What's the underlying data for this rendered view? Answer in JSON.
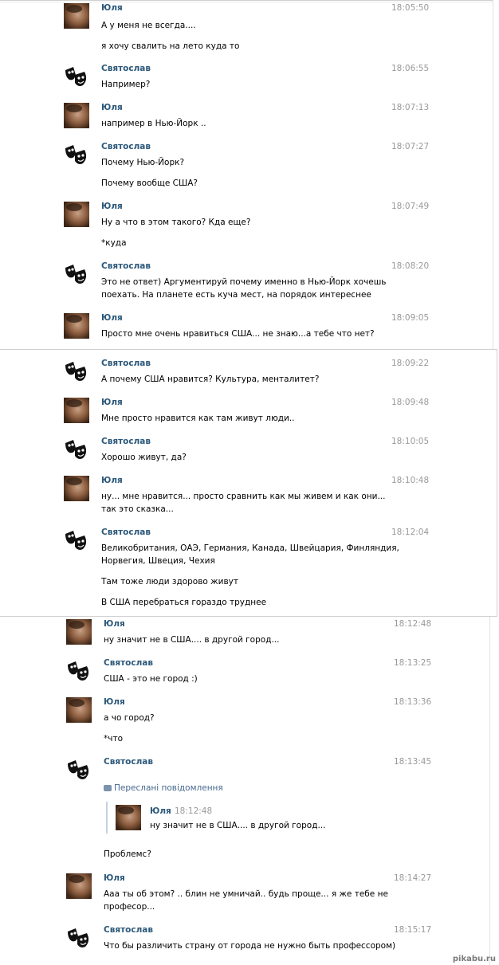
{
  "users": {
    "yulia": "Юля",
    "svyatoslav": "Святослав"
  },
  "messages": [
    {
      "author": "Юля",
      "time": "18:05:50",
      "lines": [
        "А у меня не всегда....",
        "я хочу свалить на лето куда то"
      ]
    },
    {
      "author": "Святослав",
      "time": "18:06:55",
      "lines": [
        "Например?"
      ]
    },
    {
      "author": "Юля",
      "time": "18:07:13",
      "lines": [
        "например в Нью-Йорк .."
      ]
    },
    {
      "author": "Святослав",
      "time": "18:07:27",
      "lines": [
        "Почему Нью-Йорк?",
        "Почему вообще США?"
      ]
    },
    {
      "author": "Юля",
      "time": "18:07:49",
      "lines": [
        "Ну а что в этом такого? Кда еще?",
        "*куда"
      ]
    },
    {
      "author": "Святослав",
      "time": "18:08:20",
      "lines": [
        "Это не ответ) Аргументируй почему именно в Нью-Йорк хочешь",
        "поехать. На планете есть куча мест, на порядок интереснее"
      ]
    },
    {
      "author": "Юля",
      "time": "18:09:05",
      "lines": [
        "Просто мне очень нравиться США... не знаю...а тебе что нет?"
      ]
    },
    {
      "author": "Святослав",
      "time": "18:09:22",
      "lines": [
        "А почему США нравится? Культура, менталитет?"
      ]
    },
    {
      "author": "Юля",
      "time": "18:09:48",
      "lines": [
        "Мне просто нравится как там живут люди.."
      ]
    },
    {
      "author": "Святослав",
      "time": "18:10:05",
      "lines": [
        "Хорошо живут, да?"
      ]
    },
    {
      "author": "Юля",
      "time": "18:10:48",
      "lines": [
        "ну... мне нравится... просто сравнить как мы живем и как они...",
        "так это сказка..."
      ]
    },
    {
      "author": "Святослав",
      "time": "18:12:04",
      "lines": [
        "Великобритания, ОАЭ, Германия, Канада, Швейцария, Финляндия,",
        "Норвегия, Швеция, Чехия",
        "Там тоже люди здорово живут",
        "В США перебраться гораздо труднее"
      ]
    },
    {
      "author": "Юля",
      "time": "18:12:48",
      "lines": [
        "ну значит не в США.... в другой город..."
      ]
    },
    {
      "author": "Святослав",
      "time": "18:13:25",
      "lines": [
        "США - это не город :)"
      ]
    },
    {
      "author": "Юля",
      "time": "18:13:36",
      "lines": [
        "а чо город?",
        "*что"
      ]
    },
    {
      "author": "Святослав",
      "time": "18:13:45",
      "lines": []
    },
    {
      "author": "Юля",
      "time": "18:14:27",
      "lines": [
        "Ааа ты об этом? .. блин не умничай.. будь проще... я же тебе не",
        "професор..."
      ]
    },
    {
      "author": "Святослав",
      "time": "18:15:17",
      "lines": [
        "Что бы различить страну от города не нужно быть профессором)"
      ]
    }
  ],
  "forwarded": {
    "label": "Переслані повідомлення",
    "author": "Юля",
    "time": "18:12:48",
    "text": "ну значит не в США.... в другой город...",
    "after": "Проблемс?"
  },
  "watermark": "pikabu.ru"
}
